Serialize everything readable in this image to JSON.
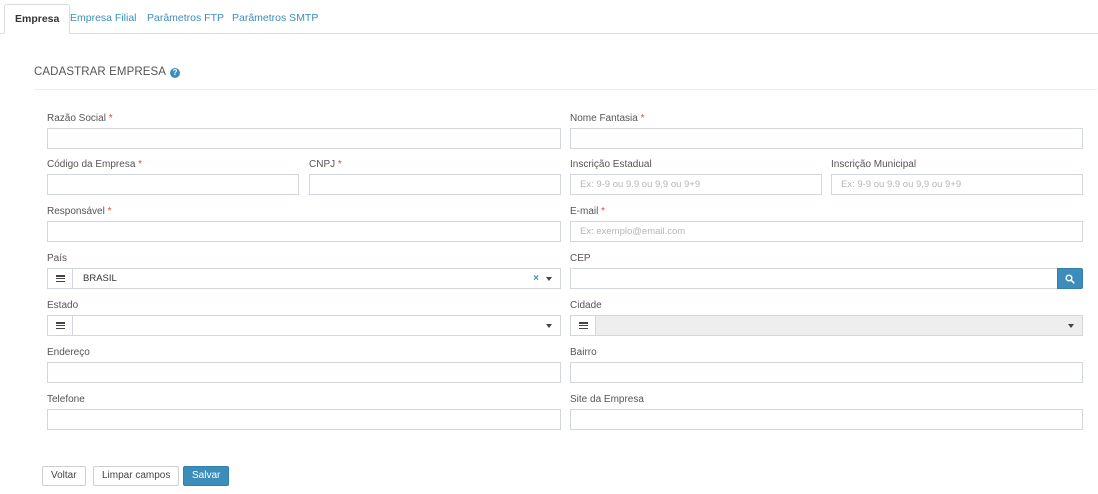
{
  "tabs": [
    {
      "label": "Empresa",
      "active": true
    },
    {
      "label": "Empresa Filial",
      "active": false
    },
    {
      "label": "Parâmetros FTP",
      "active": false
    },
    {
      "label": "Parâmetros SMTP",
      "active": false
    }
  ],
  "section": {
    "title": "CADASTRAR EMPRESA",
    "help_icon": "question-circle-icon"
  },
  "required_mark": "*",
  "fields": {
    "razao_social": {
      "label": "Razão Social",
      "value": "",
      "placeholder": ""
    },
    "nome_fantasia": {
      "label": "Nome Fantasia",
      "value": "",
      "placeholder": ""
    },
    "codigo_empresa": {
      "label": "Código da Empresa",
      "value": "",
      "placeholder": ""
    },
    "cnpj": {
      "label": "CNPJ",
      "value": "",
      "placeholder": ""
    },
    "inscricao_estadual": {
      "label": "Inscrição Estadual",
      "value": "",
      "placeholder": "Ex: 9-9 ou 9.9 ou 9,9 ou 9+9"
    },
    "inscricao_municipal": {
      "label": "Inscrição Municipal",
      "value": "",
      "placeholder": "Ex: 9-9 ou 9.9 ou 9,9 ou 9+9"
    },
    "responsavel": {
      "label": "Responsável",
      "value": "",
      "placeholder": ""
    },
    "email": {
      "label": "E-mail",
      "value": "",
      "placeholder": "Ex: exemplo@email.com"
    },
    "pais": {
      "label": "País",
      "value": "BRASIL",
      "clear": "×"
    },
    "cep": {
      "label": "CEP",
      "value": "",
      "placeholder": ""
    },
    "estado": {
      "label": "Estado",
      "value": ""
    },
    "cidade": {
      "label": "Cidade",
      "value": ""
    },
    "endereco": {
      "label": "Endereço",
      "value": "",
      "placeholder": ""
    },
    "bairro": {
      "label": "Bairro",
      "value": "",
      "placeholder": ""
    },
    "telefone": {
      "label": "Telefone",
      "value": "",
      "placeholder": ""
    },
    "site": {
      "label": "Site da Empresa",
      "value": "",
      "placeholder": ""
    }
  },
  "actions": {
    "back": "Voltar",
    "clear": "Limpar campos",
    "save": "Salvar"
  },
  "colors": {
    "primary": "#3c8dbc",
    "required": "#dd4b39",
    "border": "#d2d6de"
  }
}
